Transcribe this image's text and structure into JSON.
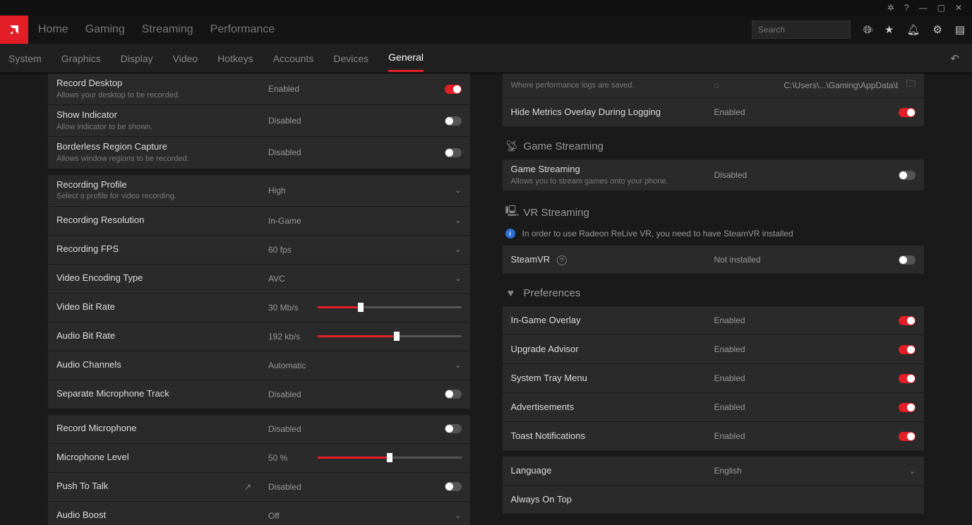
{
  "window_icons": [
    "bug",
    "help",
    "minimize",
    "maximize",
    "close"
  ],
  "nav": {
    "items": [
      "Home",
      "Gaming",
      "Streaming",
      "Performance"
    ]
  },
  "search": {
    "placeholder": "Search"
  },
  "header_icons": [
    "globe",
    "star",
    "bell",
    "settings",
    "panel"
  ],
  "active_header_icon_index": 3,
  "subtabs": [
    "System",
    "Graphics",
    "Display",
    "Video",
    "Hotkeys",
    "Accounts",
    "Devices",
    "General"
  ],
  "active_subtab_index": 7,
  "left": {
    "group1": [
      {
        "label": "Record Desktop",
        "sub": "Allows your desktop to be recorded.",
        "val": "Enabled",
        "toggle": true
      },
      {
        "label": "Show Indicator",
        "sub": "Allow indicator to be shown.",
        "val": "Disabled",
        "toggle": false
      },
      {
        "label": "Borderless Region Capture",
        "sub": "Allows window regions to be recorded.",
        "val": "Disabled",
        "toggle": false
      }
    ],
    "group2": [
      {
        "label": "Recording Profile",
        "sub": "Select a profile for video recording.",
        "val": "High",
        "type": "dropdown"
      },
      {
        "label": "Recording Resolution",
        "val": "In-Game",
        "type": "dropdown"
      },
      {
        "label": "Recording FPS",
        "val": "60 fps",
        "type": "dropdown"
      },
      {
        "label": "Video Encoding Type",
        "val": "AVC",
        "type": "dropdown"
      },
      {
        "label": "Video Bit Rate",
        "val": "30 Mb/s",
        "type": "slider",
        "pct": 30
      },
      {
        "label": "Audio Bit Rate",
        "val": "192 kb/s",
        "type": "slider",
        "pct": 55
      },
      {
        "label": "Audio Channels",
        "val": "Automatic",
        "type": "dropdown"
      },
      {
        "label": "Separate Microphone Track",
        "val": "Disabled",
        "type": "toggle",
        "toggle": false
      }
    ],
    "group3": [
      {
        "label": "Record Microphone",
        "val": "Disabled",
        "type": "toggle",
        "toggle": false
      },
      {
        "label": "Microphone Level",
        "val": "50 %",
        "type": "slider",
        "pct": 50
      },
      {
        "label": "Push To Talk",
        "val": "Disabled",
        "type": "toggle",
        "toggle": false,
        "share": true
      },
      {
        "label": "Audio Boost",
        "val": "Off",
        "type": "dropdown"
      }
    ]
  },
  "right": {
    "top_partial": {
      "sub": "Where performance logs are saved.",
      "path": "C:\\Users\\...\\Gaming\\AppData\\Local\\AMD\\CN"
    },
    "hide_metrics": {
      "label": "Hide Metrics Overlay During Logging",
      "val": "Enabled",
      "toggle": true
    },
    "game_streaming": {
      "title": "Game Streaming",
      "row": {
        "label": "Game Streaming",
        "sub": "Allows you to stream games onto your phone.",
        "val": "Disabled",
        "toggle": false
      }
    },
    "vr": {
      "title": "VR Streaming",
      "info": "In order to use Radeon ReLive VR, you need to have SteamVR installed",
      "row": {
        "label": "SteamVR",
        "val": "Not installed",
        "toggle": false
      }
    },
    "prefs": {
      "title": "Preferences",
      "rows": [
        {
          "label": "In-Game Overlay",
          "val": "Enabled",
          "toggle": true
        },
        {
          "label": "Upgrade Advisor",
          "val": "Enabled",
          "toggle": true
        },
        {
          "label": "System Tray Menu",
          "val": "Enabled",
          "toggle": true
        },
        {
          "label": "Advertisements",
          "val": "Enabled",
          "toggle": true
        },
        {
          "label": "Toast Notifications",
          "val": "Enabled",
          "toggle": true
        }
      ],
      "language": {
        "label": "Language",
        "val": "English"
      },
      "always_on_top": {
        "label": "Always On Top"
      }
    }
  }
}
